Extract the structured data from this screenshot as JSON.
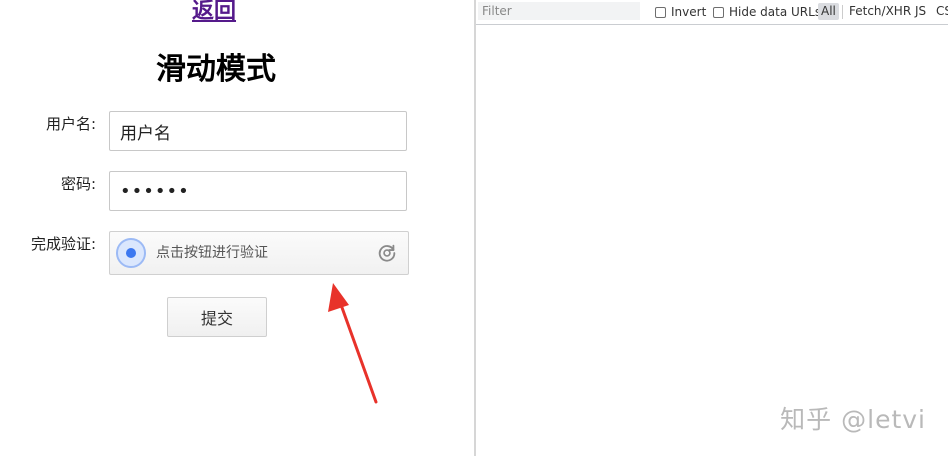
{
  "page": {
    "back_link": "返回",
    "title": "滑动模式",
    "form": {
      "username_label": "用户名:",
      "username_value": "用户名",
      "password_label": "密码:",
      "password_value": "••••••",
      "captcha_label": "完成验证:",
      "captcha_text": "点击按钮进行验证",
      "submit_label": "提交"
    }
  },
  "devtools": {
    "filter_placeholder": "Filter",
    "invert_label": "Invert",
    "hide_data_urls_label": "Hide data URLs",
    "type_filters": [
      "All",
      "Fetch/XHR",
      "JS",
      "CS"
    ],
    "active_filter": "All"
  },
  "watermark": "知乎 @letvi",
  "colors": {
    "link": "#551a8b",
    "captcha_accent": "#3c78f0",
    "arrow": "#e8322a"
  },
  "icons": {
    "captcha": "radar-dot-icon",
    "refresh": "refresh-icon",
    "annotation": "red-arrow-icon"
  }
}
